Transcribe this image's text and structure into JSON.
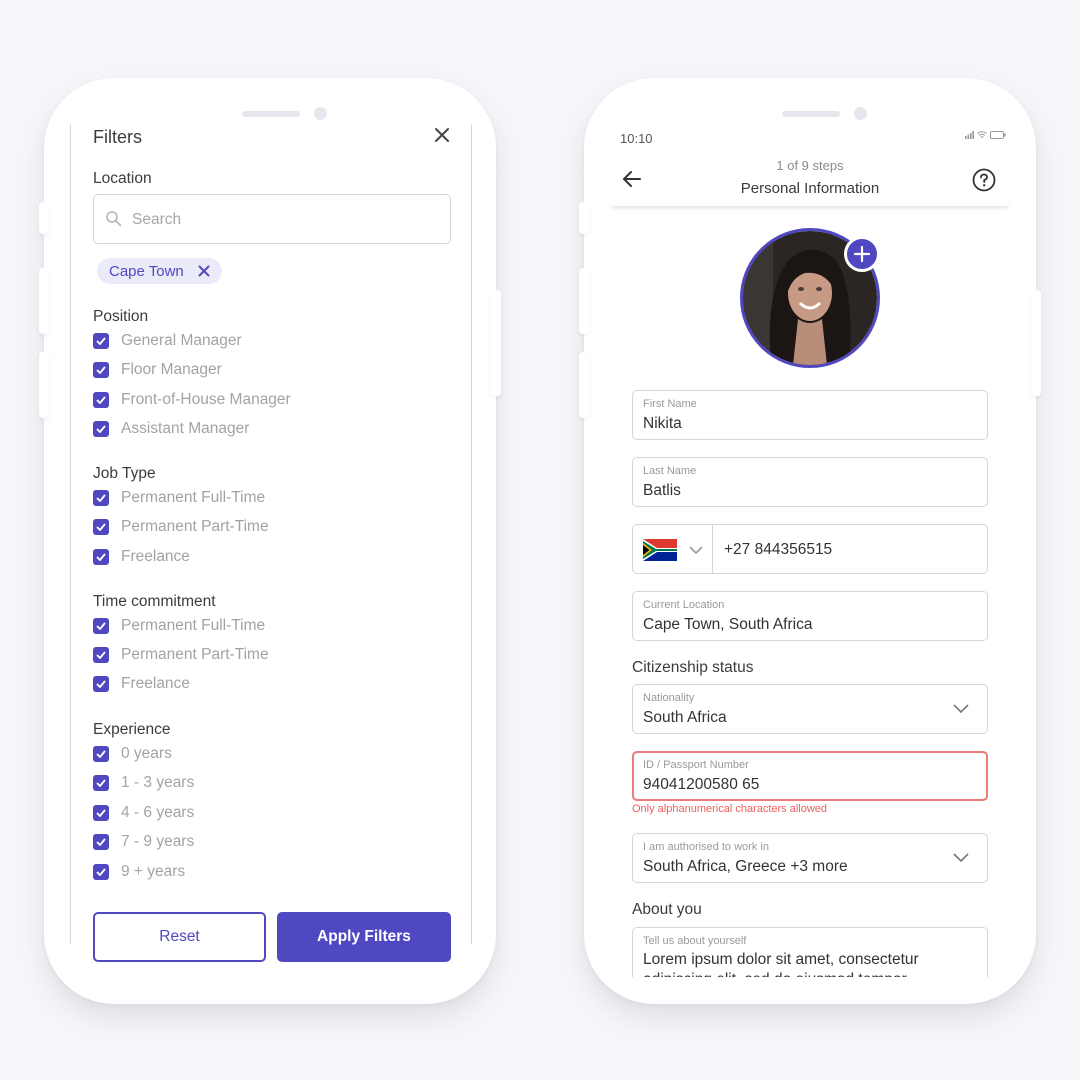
{
  "colors": {
    "accent": "#5048c0",
    "chip_bg": "#ebeaf8",
    "error": "#ef5d5d",
    "background": "#f5f6f9"
  },
  "filters": {
    "title": "Filters",
    "close_icon": "close-icon",
    "location": {
      "title": "Location",
      "search_placeholder": "Search",
      "search_value": "",
      "chips": [
        {
          "label": "Cape Town"
        }
      ]
    },
    "sections": [
      {
        "title": "Position",
        "options": [
          {
            "label": "General Manager",
            "checked": true
          },
          {
            "label": "Floor Manager",
            "checked": true
          },
          {
            "label": "Front-of-House Manager",
            "checked": true
          },
          {
            "label": "Assistant Manager",
            "checked": true
          }
        ]
      },
      {
        "title": "Job Type",
        "options": [
          {
            "label": "Permanent Full-Time",
            "checked": true
          },
          {
            "label": "Permanent Part-Time",
            "checked": true
          },
          {
            "label": "Freelance",
            "checked": true
          }
        ]
      },
      {
        "title": "Time commitment",
        "options": [
          {
            "label": "Permanent Full-Time",
            "checked": true
          },
          {
            "label": "Permanent Part-Time",
            "checked": true
          },
          {
            "label": "Freelance",
            "checked": true
          }
        ]
      },
      {
        "title": "Experience",
        "options": [
          {
            "label": "0 years",
            "checked": true
          },
          {
            "label": "1 - 3 years",
            "checked": true
          },
          {
            "label": "4 - 6 years",
            "checked": true
          },
          {
            "label": "7 - 9 years",
            "checked": true
          },
          {
            "label": "9 + years",
            "checked": true
          }
        ]
      }
    ],
    "reset_label": "Reset",
    "apply_label": "Apply Filters"
  },
  "profile": {
    "status_time": "10:10",
    "steps": "1 of 9 steps",
    "title": "Personal Information",
    "first_name": {
      "label": "First Name",
      "value": "Nikita"
    },
    "last_name": {
      "label": "Last Name",
      "value": "Batlis"
    },
    "phone": {
      "country": "South Africa",
      "value": "+27 844356515"
    },
    "current_location": {
      "label": "Current Location",
      "value": "Cape Town, South Africa"
    },
    "citizenship_title": "Citizenship status",
    "nationality": {
      "label": "Nationality",
      "value": "South Africa"
    },
    "id_number": {
      "label": "ID / Passport Number",
      "value": "94041200580 65",
      "error": "Only alphanumerical characters allowed"
    },
    "work_auth": {
      "label": "I am authorised to work in",
      "value": "South Africa, Greece +3 more"
    },
    "about_title": "About you",
    "about": {
      "label": "Tell us about yourself",
      "value": "Lorem ipsum dolor sit amet, consectetur adipiscing elit, sed do eiusmod tempor"
    }
  }
}
